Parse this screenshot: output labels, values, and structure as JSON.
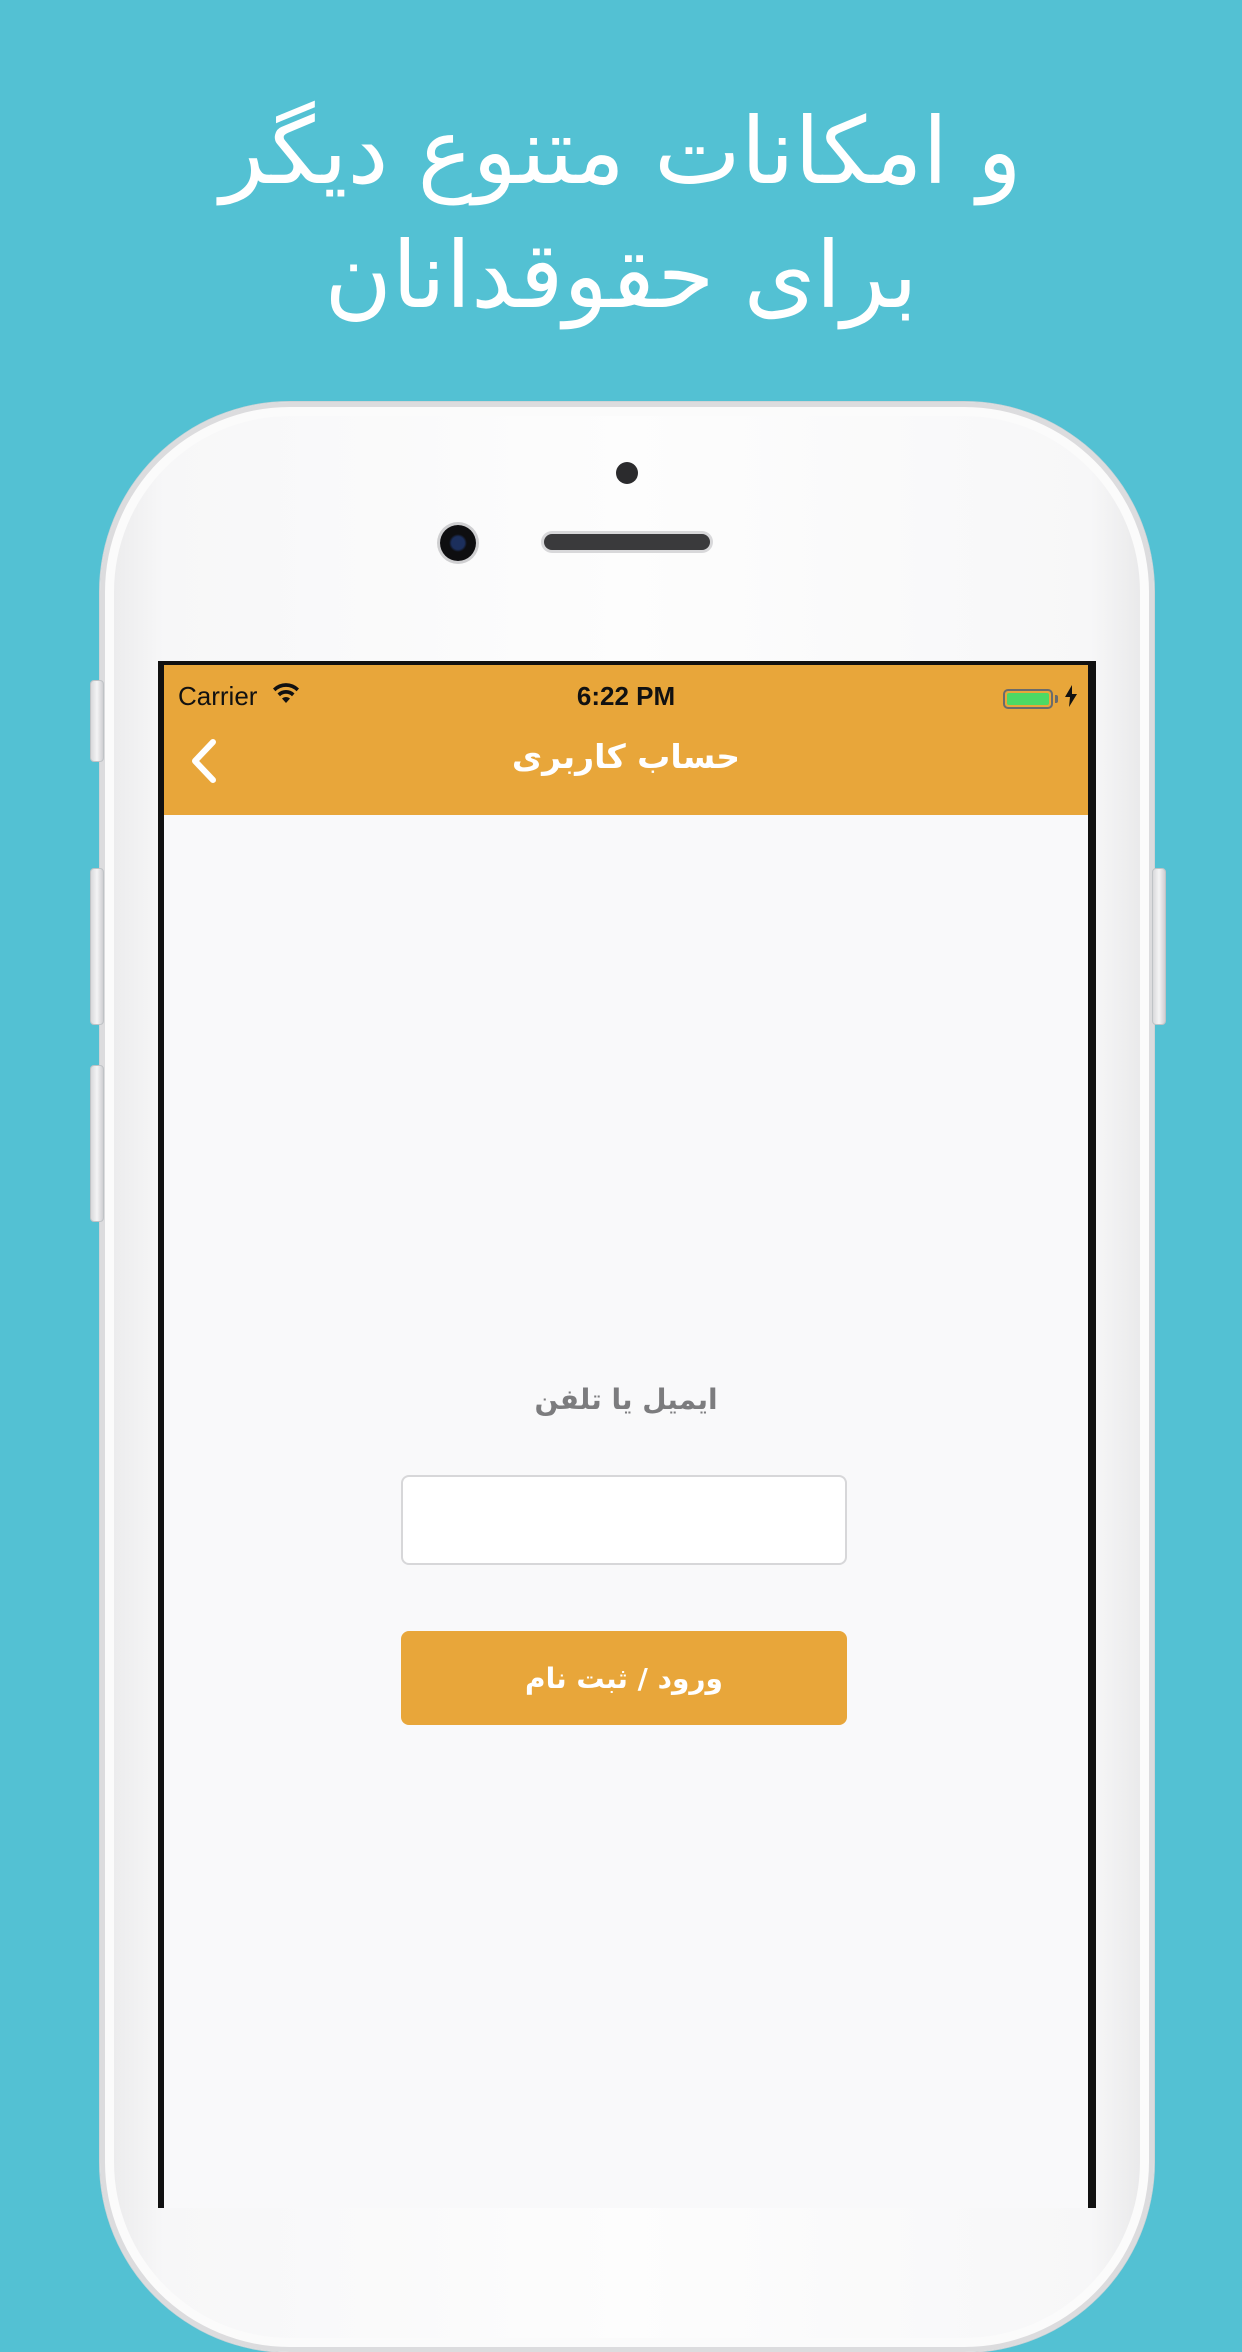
{
  "promo": {
    "line1": "و امکانات متنوع دیگر",
    "line2": "برای حقوقدانان"
  },
  "status_bar": {
    "carrier": "Carrier",
    "time": "6:22 PM",
    "wifi_icon": "wifi-icon",
    "battery_icon": "battery-charging-icon",
    "battery_level": 1.0
  },
  "navbar": {
    "title": "حساب کاربری",
    "back_icon": "chevron-left-icon"
  },
  "form": {
    "label": "ایمیل یا تلفن",
    "input_value": "",
    "submit_label": "ورود / ثبت نام"
  },
  "colors": {
    "background": "#53c1d3",
    "accent": "#e8a63a",
    "battery": "#4cd964"
  }
}
